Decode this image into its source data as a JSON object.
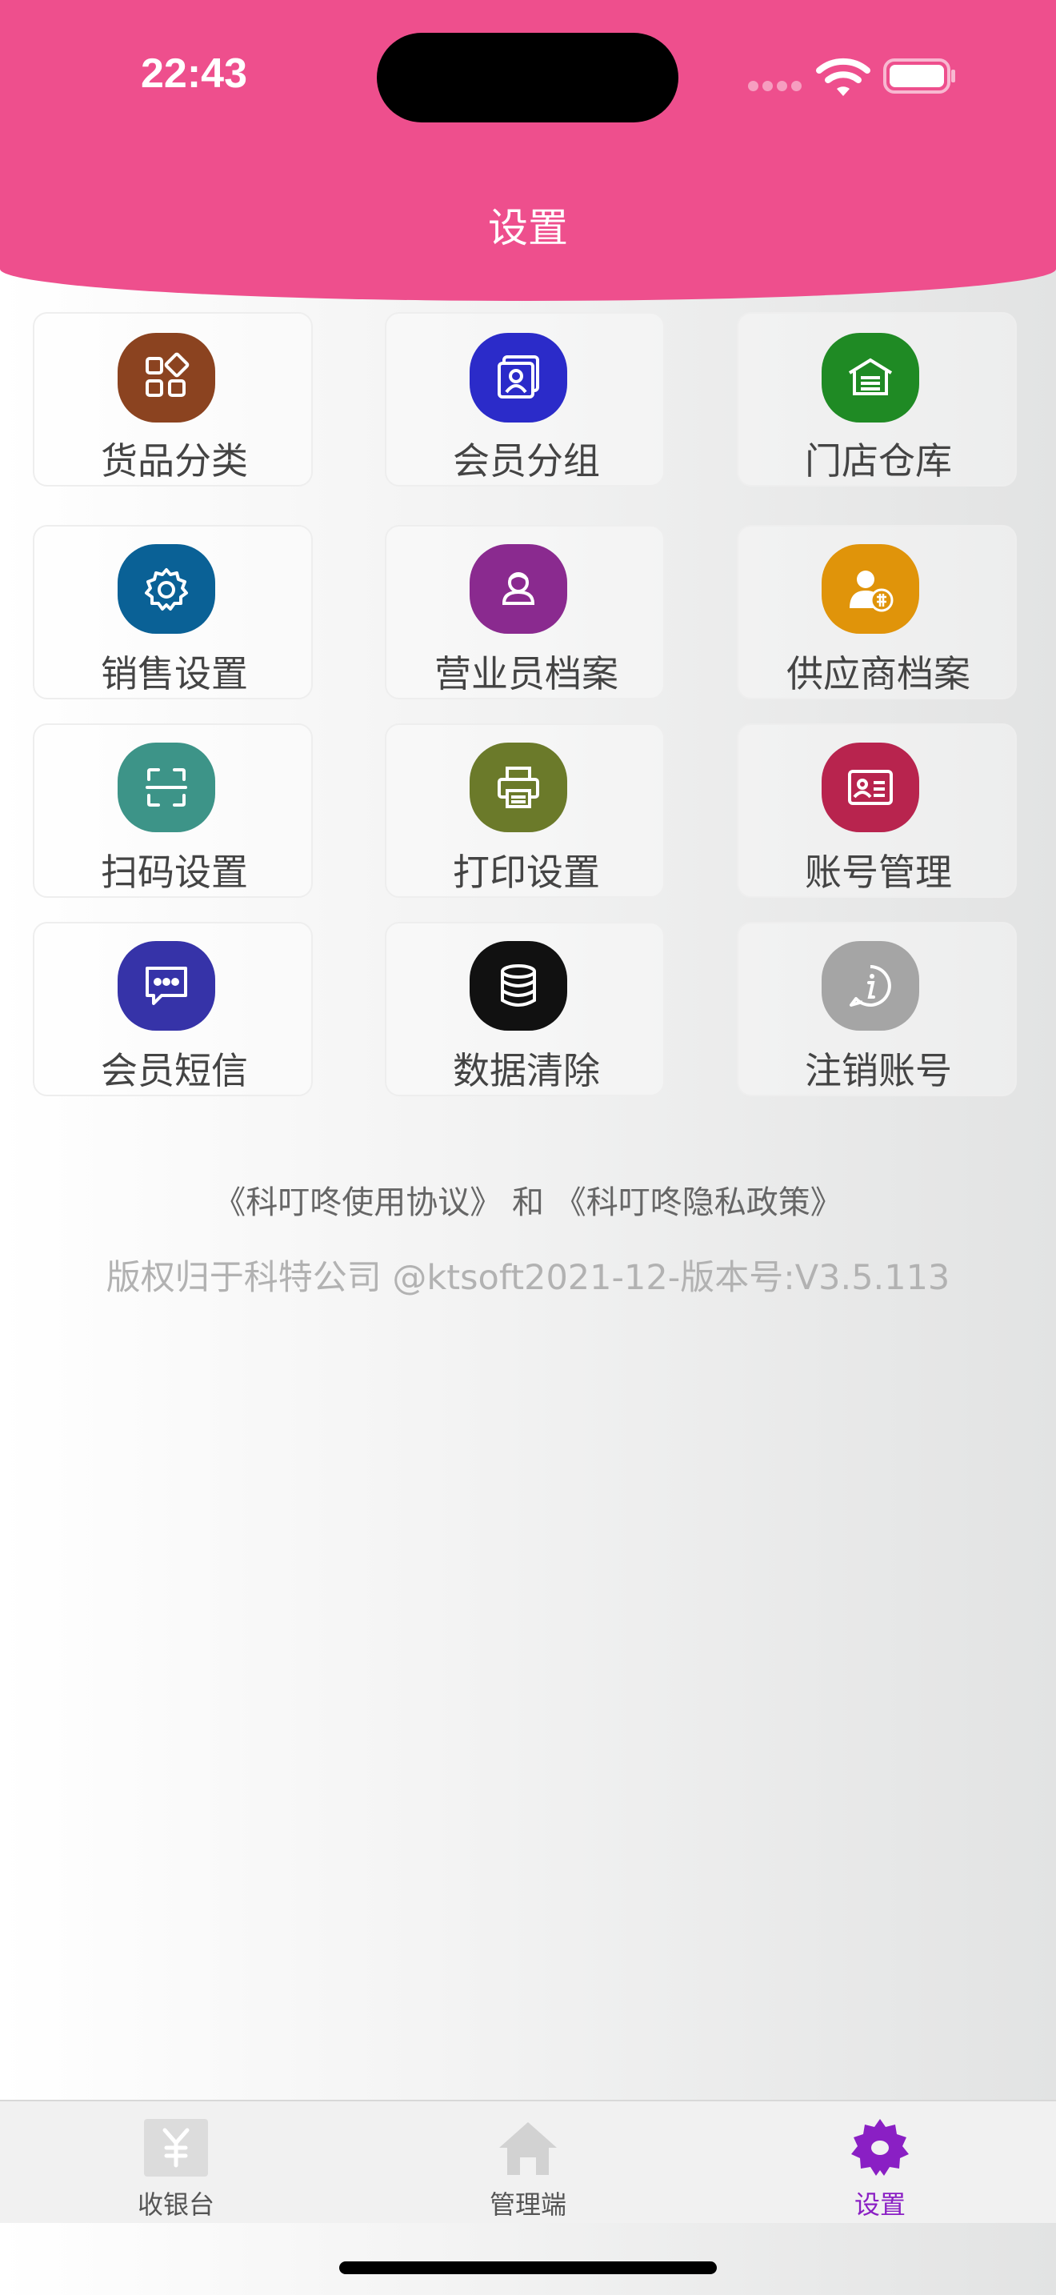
{
  "status_bar": {
    "time": "22:43"
  },
  "header": {
    "title": "设置",
    "background": "#ee4f8d"
  },
  "tiles": [
    {
      "label": "货品分类",
      "icon": "categories-icon",
      "color": "#8b4320"
    },
    {
      "label": "会员分组",
      "icon": "member-group-icon",
      "color": "#2b2bc9"
    },
    {
      "label": "门店仓库",
      "icon": "warehouse-icon",
      "color": "#1f8a24"
    },
    {
      "label": "销售设置",
      "icon": "gear-icon",
      "color": "#0a6196"
    },
    {
      "label": "营业员档案",
      "icon": "salesperson-icon",
      "color": "#8a2a8f"
    },
    {
      "label": "供应商档案",
      "icon": "supplier-icon",
      "color": "#e0940a"
    },
    {
      "label": "扫码设置",
      "icon": "scan-icon",
      "color": "#3d9488"
    },
    {
      "label": "打印设置",
      "icon": "printer-icon",
      "color": "#6b7a2a"
    },
    {
      "label": "账号管理",
      "icon": "id-card-icon",
      "color": "#b8244e"
    },
    {
      "label": "会员短信",
      "icon": "message-icon",
      "color": "#3633a8"
    },
    {
      "label": "数据清除",
      "icon": "database-icon",
      "color": "#111111"
    },
    {
      "label": "注销账号",
      "icon": "info-icon",
      "color": "#a5a5a5"
    }
  ],
  "footer": {
    "links": "《科叮咚使用协议》 和 《科叮咚隐私政策》",
    "copyright": "版权归于科特公司 @ktsoft2021-12-版本号:V3.5.113"
  },
  "tabbar": {
    "items": [
      {
        "label": "收银台",
        "icon": "cashier-icon",
        "active": false
      },
      {
        "label": "管理端",
        "icon": "home-icon",
        "active": false
      },
      {
        "label": "设置",
        "icon": "settings-icon",
        "active": true
      }
    ],
    "active_color": "#8a1fc4",
    "inactive_color": "#555555"
  }
}
